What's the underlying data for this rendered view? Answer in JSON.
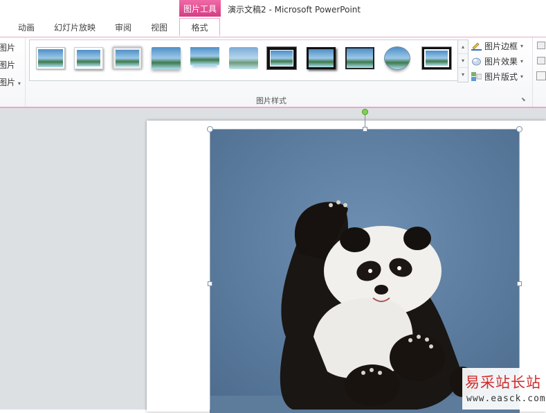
{
  "titlebar": {
    "context_tab_label": "图片工具",
    "window_title": "演示文稿2 - Microsoft PowerPoint"
  },
  "tabs": [
    {
      "label": "动画"
    },
    {
      "label": "幻灯片放映"
    },
    {
      "label": "审阅"
    },
    {
      "label": "视图"
    },
    {
      "label": "格式",
      "active": true
    }
  ],
  "ribbon": {
    "left_group_items": [
      "图片",
      "图片",
      "图片"
    ],
    "picture_styles": {
      "group_label": "图片样式",
      "thumbnail_count": 11,
      "scroll_up_icon": "chevron-up-icon",
      "scroll_down_icon": "chevron-down-icon",
      "more_icon": "more-icon"
    },
    "commands": [
      {
        "label": "图片边框",
        "icon": "pencil-border-icon"
      },
      {
        "label": "图片效果",
        "icon": "effects-icon"
      },
      {
        "label": "图片版式",
        "icon": "layout-icon"
      }
    ]
  },
  "watermark": {
    "main": "易采站长站",
    "sub": "www.easck.com"
  },
  "colors": {
    "accent_pink": "#d63c84",
    "ribbon_border": "#e7a9c5",
    "workspace_bg": "#dde0e3",
    "rotate_handle": "#7ed34d",
    "watermark_red": "#d02d2d"
  }
}
